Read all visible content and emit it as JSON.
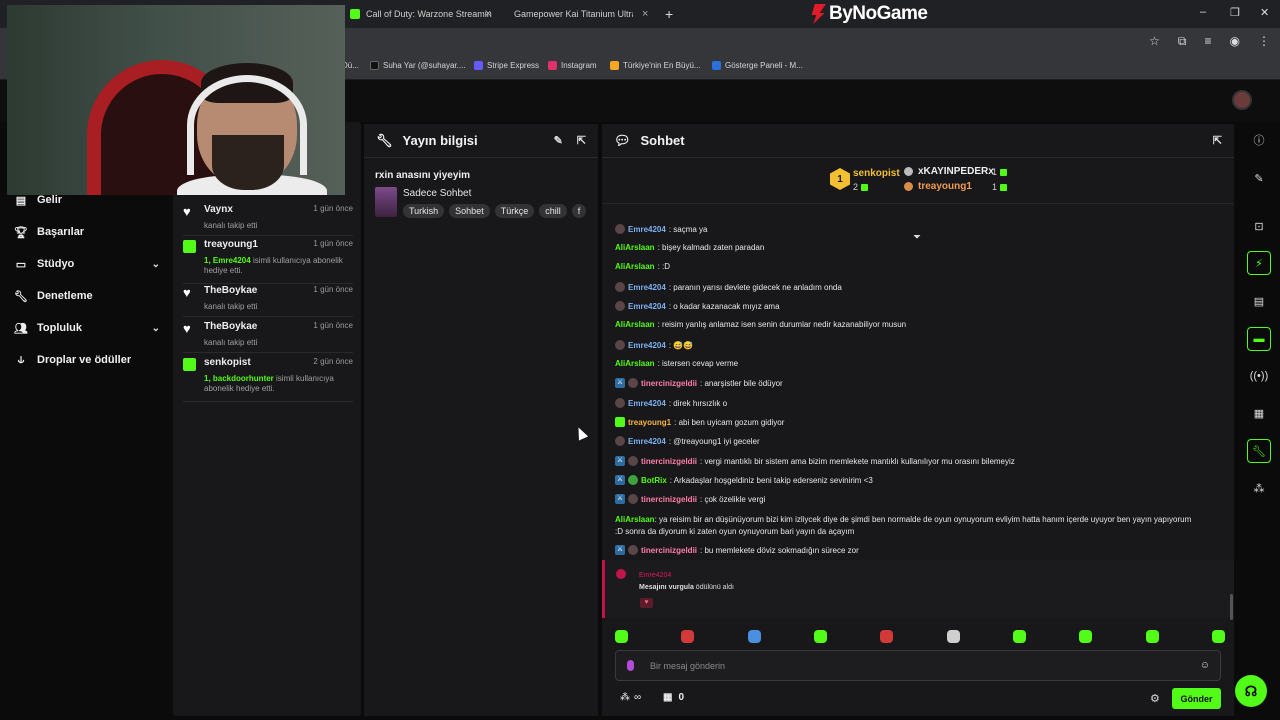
{
  "browser": {
    "tabs": [
      {
        "label": "Call of Duty: Warzone Streamin",
        "icon_color": "#53fc18"
      },
      {
        "label": "Gamepower Kai Titanium Ultra",
        "icon_color": "#e21b2b"
      }
    ],
    "new_tab": "+",
    "brand": "ByNoGame",
    "bookmarks": [
      {
        "label": "Dü...",
        "icon_color": "#555555"
      },
      {
        "label": "Suha Yar (@suhayar....",
        "icon_color": "#111111"
      },
      {
        "label": "Stripe Express",
        "icon_color": "#635bff"
      },
      {
        "label": "Instagram",
        "icon_color": "#e1306c"
      },
      {
        "label": "Türkiye'nin En Büyü...",
        "icon_color": "#f5a623"
      },
      {
        "label": "Gösterge Paneli - M...",
        "icon_color": "#2a6fdb"
      }
    ]
  },
  "leftnav": {
    "items": [
      {
        "label": "Gelir",
        "icon": "wallet-icon"
      },
      {
        "label": "Başarılar",
        "icon": "trophy-icon"
      },
      {
        "label": "Stüdyo",
        "icon": "studio-icon",
        "expandable": true
      },
      {
        "label": "Denetleme",
        "icon": "wrench-icon"
      },
      {
        "label": "Topluluk",
        "icon": "community-icon",
        "expandable": true
      },
      {
        "label": "Droplar ve ödüller",
        "icon": "drops-icon"
      }
    ]
  },
  "activity": [
    {
      "type": "follow",
      "name": "Vaynx",
      "time": "1 gün önce",
      "text": "kanalı takip etti"
    },
    {
      "type": "gift",
      "name": "treayoung1",
      "time": "1 gün önce",
      "highlight": "1, Emre4204",
      "text": "isimli kullanıcıya abonelik hediye etti."
    },
    {
      "type": "follow",
      "name": "TheBoykae",
      "time": "1 gün önce",
      "text": "kanalı takip etti"
    },
    {
      "type": "follow",
      "name": "TheBoykae",
      "time": "1 gün önce",
      "text": "kanalı takip etti"
    },
    {
      "type": "gift",
      "name": "senkopist",
      "time": "2 gün önce",
      "highlight": "1, backdoorhunter",
      "text": "isimli kullanıcıya abonelik hediye etti."
    }
  ],
  "stream_info": {
    "header": "Yayın bilgisi",
    "title": "rxin anasını yiyeyim",
    "category": "Sadece Sohbet",
    "tags": [
      "Turkish",
      "Sohbet",
      "Türkçe",
      "chill",
      "f"
    ]
  },
  "chat": {
    "header": "Sohbet",
    "leaderboard": {
      "first": {
        "rank": "1",
        "name": "senkopist",
        "count": "2"
      },
      "second": {
        "name": "xKAYINPEDERx",
        "count": "1"
      },
      "third": {
        "name": "treayoung1",
        "count": "1"
      }
    },
    "messages": [
      {
        "user": "Emre4204",
        "color": "blue",
        "badges": [
          "shield"
        ],
        "text": ": saçma ya"
      },
      {
        "user": "AliArslaan",
        "color": "green",
        "badges": [],
        "text": ": bişey kalmadı zaten paradan"
      },
      {
        "user": "AliArslaan",
        "color": "green",
        "badges": [],
        "text": ": :D"
      },
      {
        "user": "Emre4204",
        "color": "blue",
        "badges": [
          "shield"
        ],
        "text": ": paranın yarısı devlete gidecek ne anladım onda"
      },
      {
        "user": "Emre4204",
        "color": "blue",
        "badges": [
          "shield"
        ],
        "text": ": o kadar kazanacak mıyız ama"
      },
      {
        "user": "AliArslaan",
        "color": "green",
        "badges": [],
        "text": ": reisim yanlış anlamaz isen senin durumlar nedir kazanabiliyor musun"
      },
      {
        "user": "Emre4204",
        "color": "blue",
        "badges": [
          "shield"
        ],
        "text": ": 😅😅"
      },
      {
        "user": "AliArslaan",
        "color": "green",
        "badges": [],
        "text": ": istersen cevap verme"
      },
      {
        "user": "tinercinizgeldii",
        "color": "pink",
        "badges": [
          "mod",
          "shield"
        ],
        "text": ": anarşistler bile ödüyor"
      },
      {
        "user": "Emre4204",
        "color": "blue",
        "badges": [
          "shield"
        ],
        "text": ": direk hırsızlık o"
      },
      {
        "user": "treayoung1",
        "color": "orange",
        "badges": [
          "gift"
        ],
        "text": ": abi ben uyicam gozum gidiyor"
      },
      {
        "user": "Emre4204",
        "color": "blue",
        "badges": [
          "shield"
        ],
        "text": ": @treayoung1 iyi geceler"
      },
      {
        "user": "tinercinizgeldii",
        "color": "pink",
        "badges": [
          "mod",
          "shield"
        ],
        "text": ": vergi mantıklı bir sistem ama bizim memlekete mantıklı kullanılıyor mu orasını bilemeyiz"
      },
      {
        "user": "BotRix",
        "color": "green",
        "badges": [
          "mod",
          "bot"
        ],
        "text": ": Arkadaşlar hoşgeldiniz beni takip ederseniz sevinirim <3"
      },
      {
        "user": "tinercinizgeldii",
        "color": "pink",
        "badges": [
          "mod",
          "shield"
        ],
        "text": ": çok özelikle vergi"
      },
      {
        "user": "AliArslaan",
        "color": "green",
        "badges": [],
        "text": ": ya reisim bir an düşünüyorum bizi kim izliycek diye de şimdi ben normalde de oyun oynuyorum evliyim hatta hanım içerde uyuyor ben yayın yapıyorum :D sonra da diyorum ki zaten oyun oynuyorum bari yayın da açayım"
      },
      {
        "user": "tinercinizgeldii",
        "color": "pink",
        "badges": [
          "mod",
          "shield"
        ],
        "text": ": bu memlekete döviz sokmadığın sürece zor"
      }
    ],
    "highlight": {
      "user": "Emre4204",
      "bold": "Mesajını vurgula",
      "text": " ödülünü aldı"
    },
    "emote_colors": [
      "#53fc18",
      "#d23a3a",
      "#4a8fe0",
      "#53fc18",
      "#d23a3a",
      "#cfcfcf",
      "#53fc18",
      "#53fc18",
      "#53fc18",
      "#53fc18"
    ],
    "input_placeholder": "Bir mesaj gönderin",
    "points": "∞",
    "box_count": "0",
    "send_label": "Gönder"
  },
  "colors": {
    "accent": "#53fc18",
    "panel": "#18181a",
    "background": "#0b0b0c"
  }
}
